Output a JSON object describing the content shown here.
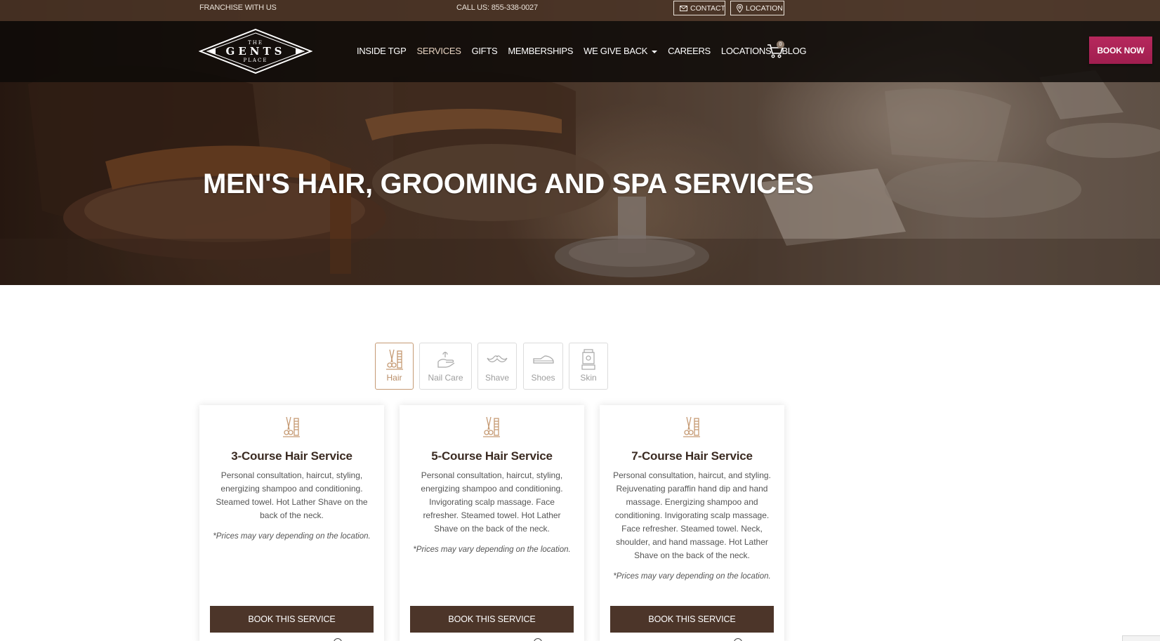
{
  "topbar": {
    "franchise_label": "FRANCHISE WITH US",
    "phone_label": "CALL US: 855-338-0027",
    "contact_label": "CONTACT",
    "location_label": "LOCATION"
  },
  "logo": {
    "line1": "THE",
    "line2": "GENTS",
    "line3": "PLACE"
  },
  "nav": {
    "items": [
      {
        "label": "INSIDE TGP"
      },
      {
        "label": "SERVICES"
      },
      {
        "label": "GIFTS"
      },
      {
        "label": "MEMBERSHIPS"
      },
      {
        "label": "WE GIVE BACK"
      },
      {
        "label": "CAREERS"
      },
      {
        "label": "LOCATIONS"
      },
      {
        "label": "BLOG"
      }
    ],
    "active_index": 1,
    "cart_count": "0",
    "book_now_label": "BOOK NOW"
  },
  "hero": {
    "title": "MEN'S HAIR, GROOMING AND SPA SERVICES"
  },
  "tabs": [
    {
      "label": "Hair",
      "icon": "hair-tools-icon"
    },
    {
      "label": "Nail Care",
      "icon": "hand-icon"
    },
    {
      "label": "Shave",
      "icon": "mustache-icon"
    },
    {
      "label": "Shoes",
      "icon": "shoe-icon"
    },
    {
      "label": "Skin",
      "icon": "skincare-bottle-icon"
    }
  ],
  "cards": [
    {
      "title": "3-Course Hair Service",
      "description": "Personal consultation, haircut, styling, energizing shampoo and conditioning. Steamed towel. Hot Lather Shave on the back of the neck.",
      "note": "*Prices may vary depending on the location.",
      "button": "BOOK THIS SERVICE"
    },
    {
      "title": "5-Course Hair Service",
      "description": "Personal consultation, haircut, styling, energizing shampoo and conditioning. Invigorating scalp massage. Face refresher. Steamed towel. Hot Lather Shave on the back of the neck.",
      "note": "*Prices may vary depending on the location.",
      "button": "BOOK THIS SERVICE"
    },
    {
      "title": "7-Course Hair Service",
      "description": "Personal consultation, haircut, and styling. Rejuvenating paraffin hand dip and hand massage. Energizing shampoo and conditioning. Invigorating scalp massage. Face refresher. Steamed towel. Neck, shoulder, and hand massage. Hot Lather Shave on the back of the neck.",
      "note": "*Prices may vary depending on the location.",
      "button": "BOOK THIS SERVICE"
    }
  ],
  "colors": {
    "accent": "#c59a74",
    "book_now": "#a01e4f",
    "card_button": "#4c3529",
    "title_text": "#3b2b22"
  }
}
